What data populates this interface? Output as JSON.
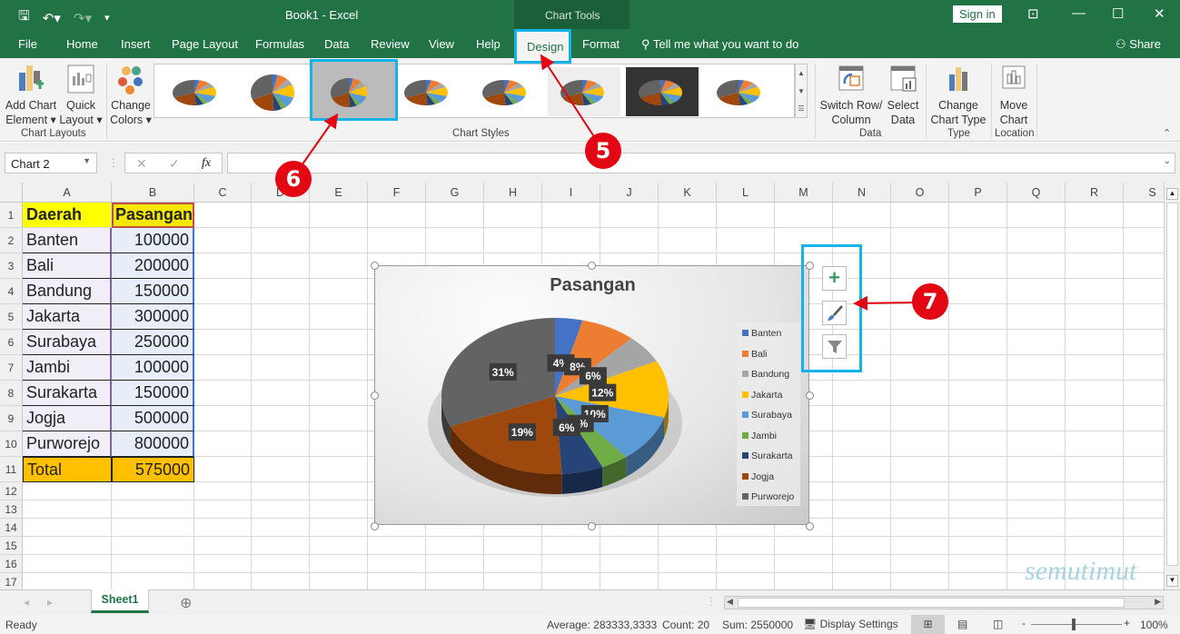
{
  "window": {
    "title": "Book1  -  Excel",
    "contextual_group": "Chart Tools",
    "sign_in": "Sign in",
    "qat": {
      "save_icon": "save-icon",
      "undo_icon": "undo-icon",
      "redo_icon": "redo-icon",
      "customize_icon": "customize-qat-icon"
    }
  },
  "tabs": [
    "File",
    "Home",
    "Insert",
    "Page Layout",
    "Formulas",
    "Data",
    "Review",
    "View",
    "Help",
    "Design",
    "Format"
  ],
  "active_tab": "Design",
  "tell_me": "Tell me what you want to do",
  "share": "Share",
  "ribbon": {
    "chart_layouts": {
      "group_label": "Chart Layouts",
      "add_chart_element": [
        "Add Chart",
        "Element ▾"
      ],
      "quick_layout": [
        "Quick",
        "Layout ▾"
      ]
    },
    "change_colors": [
      "Change",
      "Colors ▾"
    ],
    "chart_styles": {
      "group_label": "Chart Styles",
      "style_count_visible": 8,
      "selected_style_index": 3
    },
    "data": {
      "group_label": "Data",
      "switch_row_column": [
        "Switch Row/",
        "Column"
      ],
      "select_data": [
        "Select",
        "Data"
      ]
    },
    "type": {
      "group_label": "Type",
      "change_chart_type": [
        "Change",
        "Chart Type"
      ]
    },
    "location": {
      "group_label": "Location",
      "move_chart": [
        "Move",
        "Chart"
      ]
    }
  },
  "formula_bar": {
    "name_box": "Chart 2",
    "cancel": "✕",
    "enter": "✓",
    "fx": "fx",
    "value": ""
  },
  "columns": [
    "A",
    "B",
    "C",
    "D",
    "E",
    "F",
    "G",
    "H",
    "I",
    "J",
    "K",
    "L",
    "M",
    "N",
    "O",
    "P",
    "Q",
    "R",
    "S"
  ],
  "rows": [
    "1",
    "2",
    "3",
    "4",
    "5",
    "6",
    "7",
    "8",
    "9",
    "10",
    "11",
    "12",
    "13",
    "14",
    "15",
    "16",
    "17"
  ],
  "table": {
    "headers": [
      "Daerah",
      "Pasangan"
    ],
    "rows": [
      [
        "Banten",
        "100000"
      ],
      [
        "Bali",
        "200000"
      ],
      [
        "Bandung",
        "150000"
      ],
      [
        "Jakarta",
        "300000"
      ],
      [
        "Surabaya",
        "250000"
      ],
      [
        "Jambi",
        "100000"
      ],
      [
        "Surakarta",
        "150000"
      ],
      [
        "Jogja",
        "500000"
      ],
      [
        "Purworejo",
        "800000"
      ]
    ],
    "total": [
      "Total",
      "575000"
    ]
  },
  "chart_data": {
    "type": "pie",
    "title": "Pasangan",
    "categories": [
      "Banten",
      "Bali",
      "Bandung",
      "Jakarta",
      "Surabaya",
      "Jambi",
      "Surakarta",
      "Jogja",
      "Purworejo"
    ],
    "values": [
      100000,
      200000,
      150000,
      300000,
      250000,
      100000,
      150000,
      500000,
      800000
    ],
    "data_labels": [
      "4%",
      "8%",
      "6%",
      "12%",
      "10%",
      "4%",
      "6%",
      "19%",
      "31%"
    ],
    "colors": [
      "#4472c4",
      "#ed7d31",
      "#a5a5a5",
      "#ffc000",
      "#5b9bd5",
      "#70ad47",
      "#264478",
      "#9e480e",
      "#636363"
    ],
    "legend_position": "right",
    "style": "3-D pie"
  },
  "chart_side_buttons": [
    {
      "name": "chart-elements-button",
      "icon": "plus-icon"
    },
    {
      "name": "chart-styles-button",
      "icon": "paintbrush-icon"
    },
    {
      "name": "chart-filters-button",
      "icon": "filter-icon"
    }
  ],
  "annotations": [
    "5",
    "6",
    "7"
  ],
  "sheet_tabs": [
    "Sheet1"
  ],
  "watermark": "semutimut",
  "status": {
    "ready": "Ready",
    "average": "Average: 283333,3333",
    "count": "Count: 20",
    "sum": "Sum: 2550000",
    "display_settings": "Display Settings",
    "zoom": "100%"
  },
  "accent_color": "#217346",
  "highlight_color": "#14b4ea"
}
